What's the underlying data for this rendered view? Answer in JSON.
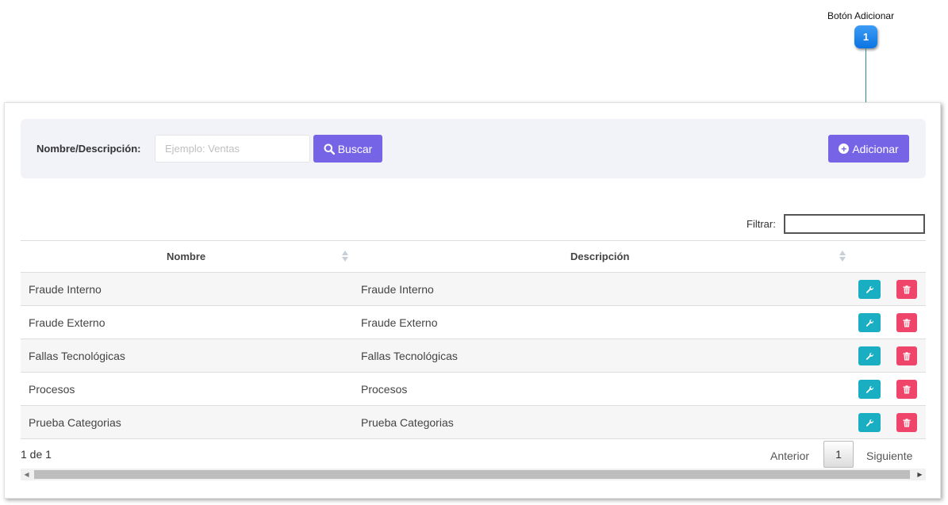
{
  "callout": {
    "label": "Botón  Adicionar",
    "number": "1"
  },
  "search": {
    "label": "Nombre/Descripción:",
    "placeholder": "Ejemplo: Ventas",
    "search_button": "Buscar",
    "add_button": "Adicionar"
  },
  "filter": {
    "label": "Filtrar:",
    "value": ""
  },
  "table": {
    "headers": {
      "name": "Nombre",
      "description": "Descripción"
    },
    "rows": [
      {
        "name": "Fraude Interno",
        "description": "Fraude Interno"
      },
      {
        "name": "Fraude Externo",
        "description": "Fraude Externo"
      },
      {
        "name": "Fallas Tecnológicas",
        "description": "Fallas Tecnológicas"
      },
      {
        "name": "Procesos",
        "description": "Procesos"
      },
      {
        "name": "Prueba Categorias",
        "description": "Prueba Categorias"
      }
    ]
  },
  "pagination": {
    "info": "1 de 1",
    "previous": "Anterior",
    "current_page": "1",
    "next": "Siguiente"
  },
  "colors": {
    "primary": "#7565e6",
    "edit": "#1aaec3",
    "delete": "#f0456a",
    "callout": "#0b74e3"
  },
  "icons": {
    "search": "search-icon",
    "add": "plus-circle-icon",
    "edit": "wrench-icon",
    "delete": "trash-icon"
  }
}
